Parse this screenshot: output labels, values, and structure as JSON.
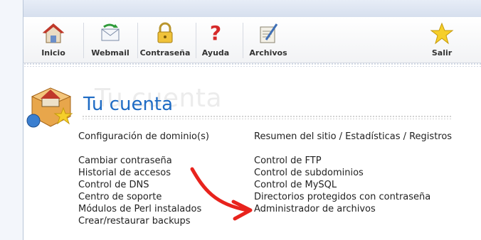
{
  "toolbar": {
    "items": [
      {
        "label": "Inicio",
        "icon": "home-icon"
      },
      {
        "label": "Webmail",
        "icon": "webmail-icon"
      },
      {
        "label": "Contraseña",
        "icon": "lock-icon"
      },
      {
        "label": "Ayuda",
        "icon": "help-icon"
      },
      {
        "label": "Archivos",
        "icon": "files-icon"
      },
      {
        "label": "Salir",
        "icon": "star-icon"
      }
    ]
  },
  "page": {
    "title": "Tu cuenta",
    "watermark": "Tu cuenta"
  },
  "links": {
    "left": [
      "Configuración de dominio(s)",
      "Cambiar contraseña",
      "Historial de accesos",
      "Control de DNS",
      "Centro de soporte",
      "Módulos de Perl instalados",
      "Crear/restaurar backups"
    ],
    "right": [
      "Resumen del sitio / Estadísticas / Registros",
      "Control de FTP",
      "Control de subdominios",
      "Control de MySQL",
      "Directorios protegidos con contraseña",
      "Administrador de archivos"
    ]
  },
  "colors": {
    "title": "#1e6bc4",
    "arrow": "#e8231d"
  }
}
